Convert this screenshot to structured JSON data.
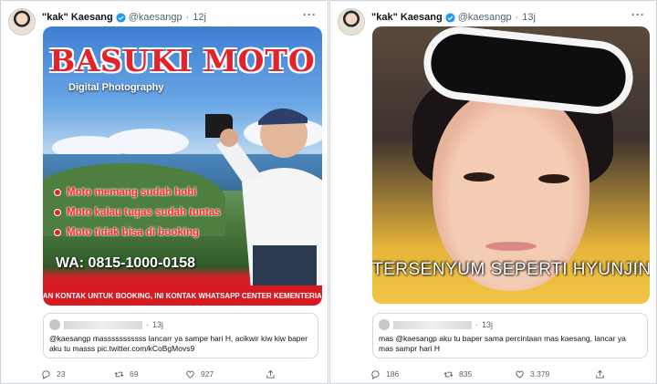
{
  "tweets": [
    {
      "author_name": "\"kak\" Kaesang",
      "handle": "@kaesangp",
      "separator": "·",
      "time": "12j",
      "image": {
        "title": "BASUKI MOTO",
        "subtitle": "Digital Photography",
        "bullets": [
          "Moto memang sudah hobi",
          "Moto kalau tugas sudah tuntas",
          "Moto tidak bisa di booking"
        ],
        "phone": "WA: 0815-1000-0158",
        "banner": "INI BUKAN KONTAK UNTUK BOOKING, INI KONTAK WHATSAPP CENTER KEMENTERIAN PUPR"
      },
      "quote": {
        "time": "13j",
        "text": "@kaesangp masssssssssss lancarr ya sampe hari H, acikwir kiw kiw baper aku tu masss pic.twitter.com/kCoBgMovs9"
      },
      "counts": {
        "reply": "23",
        "retweet": "69",
        "like": "927"
      }
    },
    {
      "author_name": "\"kak\" Kaesang",
      "handle": "@kaesangp",
      "separator": "·",
      "time": "13j",
      "image": {
        "caption": "TERSENYUM SEPERTI HYUNJIN"
      },
      "quote": {
        "time": "13j",
        "text": "mas @kaesangp aku tu baper sama percintaan mas kaesang, lancar ya mas sampr hari H"
      },
      "counts": {
        "reply": "186",
        "retweet": "835",
        "like": "3.379"
      }
    }
  ],
  "colors": {
    "verified": "#1d9bf0",
    "text": "#0f1419",
    "muted": "#536471"
  }
}
